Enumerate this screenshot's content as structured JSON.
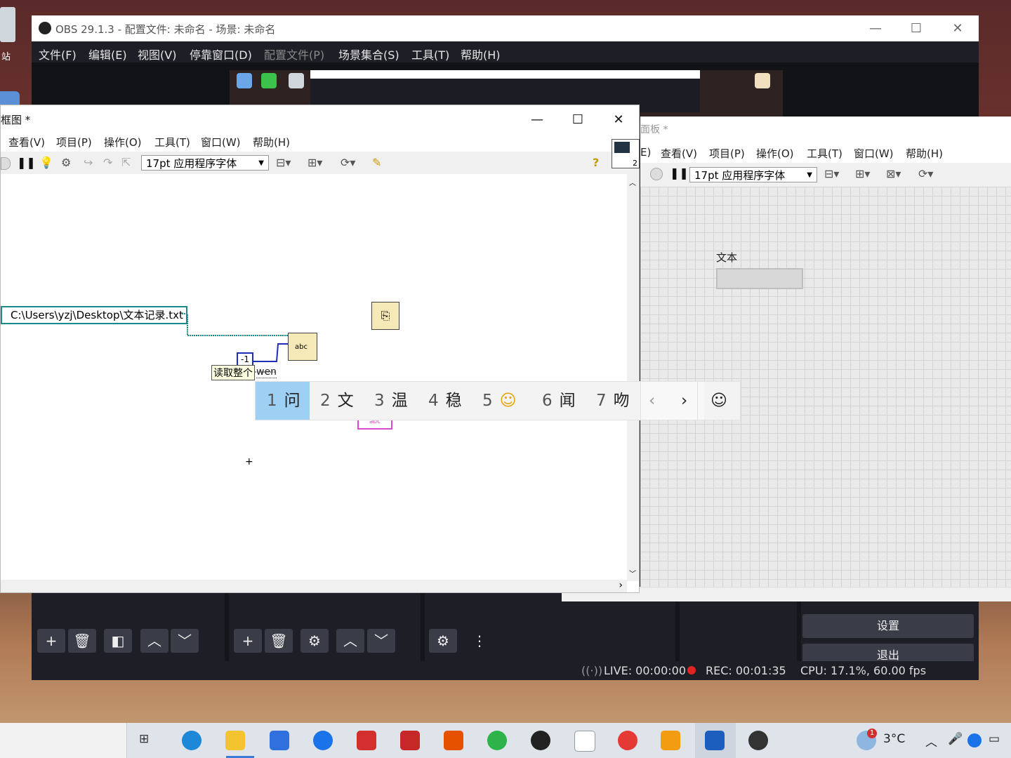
{
  "obs": {
    "title": "OBS 29.1.3 - 配置文件: 未命名 - 场景: 未命名",
    "menu": [
      "文件(F)",
      "编辑(E)",
      "视图(V)",
      "停靠窗口(D)",
      "配置文件(P)",
      "场景集合(S)",
      "工具(T)",
      "帮助(H)"
    ],
    "controls": {
      "settings": "设置",
      "exit": "退出"
    },
    "status": {
      "live": "LIVE: 00:00:00",
      "rec": "REC: 00:01:35",
      "cpu": "CPU: 17.1%, 60.00 fps"
    }
  },
  "desktop": {
    "recycle_label": "站"
  },
  "front_panel": {
    "title": "面板 *",
    "menu": [
      "E)",
      "查看(V)",
      "项目(P)",
      "操作(O)",
      "工具(T)",
      "窗口(W)",
      "帮助(H)"
    ],
    "font": "17pt 应用程序字体",
    "control_label": "文本"
  },
  "block_diagram": {
    "title": "框图 *",
    "menu": [
      "查看(V)",
      "项目(P)",
      "操作(O)",
      "工具(T)",
      "窗口(W)",
      "帮助(H)"
    ],
    "font": "17pt 应用程序字体",
    "path_constant": "C:\\Users\\yzj\\Desktop\\文本记录.txt",
    "numeric_constant": "-1",
    "tooltip": "读取整个",
    "ime_composition": "wen",
    "vi_icon_number": "2"
  },
  "ime": {
    "candidates": [
      {
        "num": "1",
        "text": "问"
      },
      {
        "num": "2",
        "text": "文"
      },
      {
        "num": "3",
        "text": "温"
      },
      {
        "num": "4",
        "text": "稳"
      },
      {
        "num": "5",
        "text": "☺"
      },
      {
        "num": "6",
        "text": "闻"
      },
      {
        "num": "7",
        "text": "吻"
      }
    ],
    "prev": "‹",
    "next": "›",
    "emoji": "☺"
  },
  "taskbar": {
    "temperature": "3°C",
    "weather_badge": "1"
  },
  "colors": {
    "obs_bg": "#2b2e38",
    "obs_dark": "#1e1f26",
    "rec_dot": "#e02424",
    "ime_selected": "#9dd0f2",
    "path_border": "#1b8a8a"
  }
}
